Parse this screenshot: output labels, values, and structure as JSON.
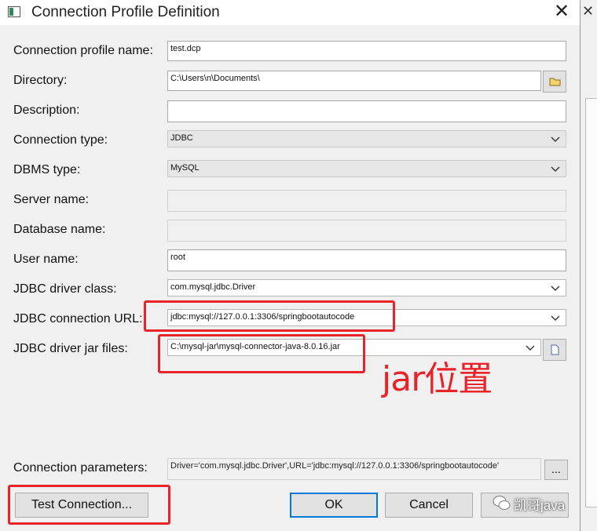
{
  "dialog": {
    "title": "Connection Profile Definition",
    "close_glyph": "✕",
    "app_icon": "window-icon"
  },
  "fields": {
    "profile_name": {
      "label": "Connection profile name:",
      "value": "test.dcp"
    },
    "directory": {
      "label": "Directory:",
      "value": "C:\\Users\\n\\Documents\\"
    },
    "description": {
      "label": "Description:",
      "value": ""
    },
    "connection_type": {
      "label": "Connection type:",
      "value": "JDBC"
    },
    "dbms_type": {
      "label": "DBMS type:",
      "value": "MySQL"
    },
    "server_name": {
      "label": "Server name:",
      "value": ""
    },
    "database_name": {
      "label": "Database name:",
      "value": ""
    },
    "user_name": {
      "label": "User name:",
      "value": "root"
    },
    "driver_class": {
      "label": "JDBC driver class:",
      "value": "com.mysql.jdbc.Driver"
    },
    "connection_url": {
      "label": "JDBC connection URL:",
      "value": "jdbc:mysql://127.0.0.1:3306/springbootautocode"
    },
    "driver_jar": {
      "label": "JDBC driver jar files:",
      "value": "C:\\mysql-jar\\mysql-connector-java-8.0.16.jar"
    },
    "connection_params": {
      "label": "Connection parameters:",
      "value": "Driver='com.mysql.jdbc.Driver',URL='jdbc:mysql://127.0.0.1:3306/springbootautocode'"
    }
  },
  "buttons": {
    "ellipsis": "...",
    "test": "Test Connection...",
    "ok": "OK",
    "cancel": "Cancel"
  },
  "annotation": {
    "text": "jar位置",
    "color": "#e8232a"
  },
  "watermark": {
    "text": "凯哥java"
  },
  "colors": {
    "accent": "#0078d7",
    "highlight": "#e8232a"
  }
}
